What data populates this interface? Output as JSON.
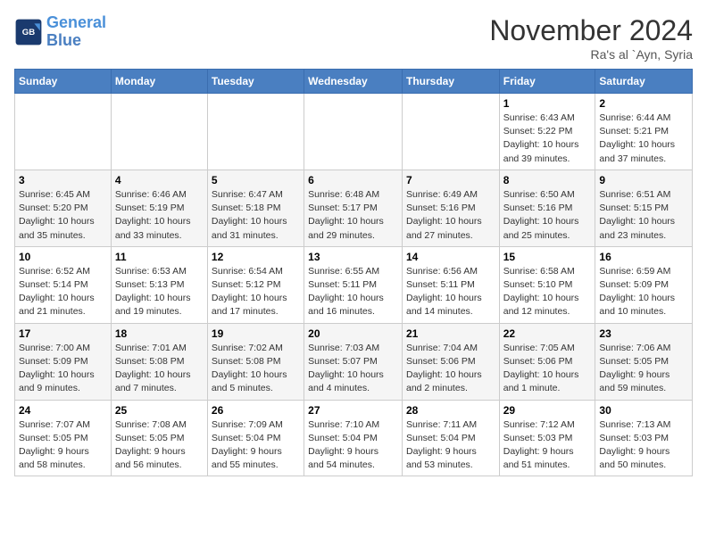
{
  "logo": {
    "line1": "General",
    "line2": "Blue"
  },
  "title": "November 2024",
  "location": "Ra's al `Ayn, Syria",
  "days_of_week": [
    "Sunday",
    "Monday",
    "Tuesday",
    "Wednesday",
    "Thursday",
    "Friday",
    "Saturday"
  ],
  "weeks": [
    [
      {
        "day": "",
        "info": ""
      },
      {
        "day": "",
        "info": ""
      },
      {
        "day": "",
        "info": ""
      },
      {
        "day": "",
        "info": ""
      },
      {
        "day": "",
        "info": ""
      },
      {
        "day": "1",
        "info": "Sunrise: 6:43 AM\nSunset: 5:22 PM\nDaylight: 10 hours\nand 39 minutes."
      },
      {
        "day": "2",
        "info": "Sunrise: 6:44 AM\nSunset: 5:21 PM\nDaylight: 10 hours\nand 37 minutes."
      }
    ],
    [
      {
        "day": "3",
        "info": "Sunrise: 6:45 AM\nSunset: 5:20 PM\nDaylight: 10 hours\nand 35 minutes."
      },
      {
        "day": "4",
        "info": "Sunrise: 6:46 AM\nSunset: 5:19 PM\nDaylight: 10 hours\nand 33 minutes."
      },
      {
        "day": "5",
        "info": "Sunrise: 6:47 AM\nSunset: 5:18 PM\nDaylight: 10 hours\nand 31 minutes."
      },
      {
        "day": "6",
        "info": "Sunrise: 6:48 AM\nSunset: 5:17 PM\nDaylight: 10 hours\nand 29 minutes."
      },
      {
        "day": "7",
        "info": "Sunrise: 6:49 AM\nSunset: 5:16 PM\nDaylight: 10 hours\nand 27 minutes."
      },
      {
        "day": "8",
        "info": "Sunrise: 6:50 AM\nSunset: 5:16 PM\nDaylight: 10 hours\nand 25 minutes."
      },
      {
        "day": "9",
        "info": "Sunrise: 6:51 AM\nSunset: 5:15 PM\nDaylight: 10 hours\nand 23 minutes."
      }
    ],
    [
      {
        "day": "10",
        "info": "Sunrise: 6:52 AM\nSunset: 5:14 PM\nDaylight: 10 hours\nand 21 minutes."
      },
      {
        "day": "11",
        "info": "Sunrise: 6:53 AM\nSunset: 5:13 PM\nDaylight: 10 hours\nand 19 minutes."
      },
      {
        "day": "12",
        "info": "Sunrise: 6:54 AM\nSunset: 5:12 PM\nDaylight: 10 hours\nand 17 minutes."
      },
      {
        "day": "13",
        "info": "Sunrise: 6:55 AM\nSunset: 5:11 PM\nDaylight: 10 hours\nand 16 minutes."
      },
      {
        "day": "14",
        "info": "Sunrise: 6:56 AM\nSunset: 5:11 PM\nDaylight: 10 hours\nand 14 minutes."
      },
      {
        "day": "15",
        "info": "Sunrise: 6:58 AM\nSunset: 5:10 PM\nDaylight: 10 hours\nand 12 minutes."
      },
      {
        "day": "16",
        "info": "Sunrise: 6:59 AM\nSunset: 5:09 PM\nDaylight: 10 hours\nand 10 minutes."
      }
    ],
    [
      {
        "day": "17",
        "info": "Sunrise: 7:00 AM\nSunset: 5:09 PM\nDaylight: 10 hours\nand 9 minutes."
      },
      {
        "day": "18",
        "info": "Sunrise: 7:01 AM\nSunset: 5:08 PM\nDaylight: 10 hours\nand 7 minutes."
      },
      {
        "day": "19",
        "info": "Sunrise: 7:02 AM\nSunset: 5:08 PM\nDaylight: 10 hours\nand 5 minutes."
      },
      {
        "day": "20",
        "info": "Sunrise: 7:03 AM\nSunset: 5:07 PM\nDaylight: 10 hours\nand 4 minutes."
      },
      {
        "day": "21",
        "info": "Sunrise: 7:04 AM\nSunset: 5:06 PM\nDaylight: 10 hours\nand 2 minutes."
      },
      {
        "day": "22",
        "info": "Sunrise: 7:05 AM\nSunset: 5:06 PM\nDaylight: 10 hours\nand 1 minute."
      },
      {
        "day": "23",
        "info": "Sunrise: 7:06 AM\nSunset: 5:05 PM\nDaylight: 9 hours\nand 59 minutes."
      }
    ],
    [
      {
        "day": "24",
        "info": "Sunrise: 7:07 AM\nSunset: 5:05 PM\nDaylight: 9 hours\nand 58 minutes."
      },
      {
        "day": "25",
        "info": "Sunrise: 7:08 AM\nSunset: 5:05 PM\nDaylight: 9 hours\nand 56 minutes."
      },
      {
        "day": "26",
        "info": "Sunrise: 7:09 AM\nSunset: 5:04 PM\nDaylight: 9 hours\nand 55 minutes."
      },
      {
        "day": "27",
        "info": "Sunrise: 7:10 AM\nSunset: 5:04 PM\nDaylight: 9 hours\nand 54 minutes."
      },
      {
        "day": "28",
        "info": "Sunrise: 7:11 AM\nSunset: 5:04 PM\nDaylight: 9 hours\nand 53 minutes."
      },
      {
        "day": "29",
        "info": "Sunrise: 7:12 AM\nSunset: 5:03 PM\nDaylight: 9 hours\nand 51 minutes."
      },
      {
        "day": "30",
        "info": "Sunrise: 7:13 AM\nSunset: 5:03 PM\nDaylight: 9 hours\nand 50 minutes."
      }
    ]
  ]
}
